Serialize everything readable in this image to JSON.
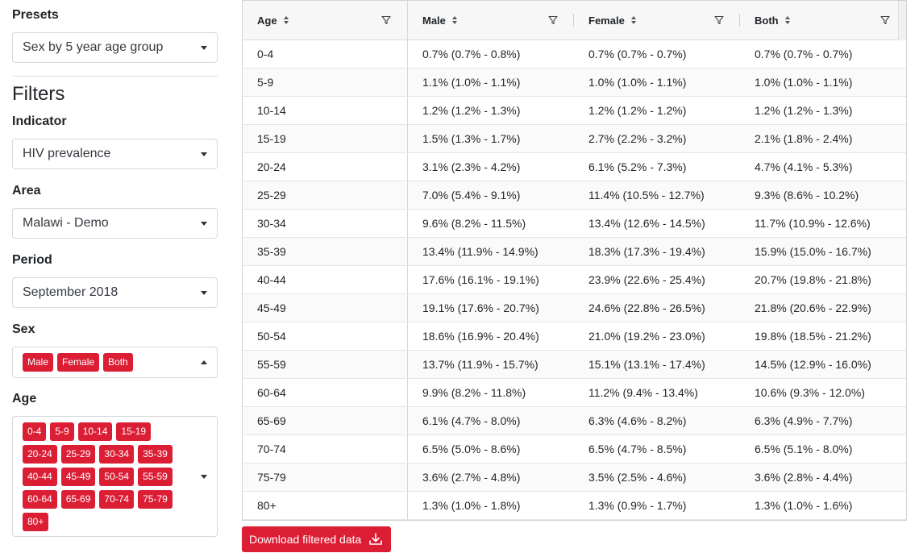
{
  "sidebar": {
    "presets": {
      "label": "Presets",
      "selected": "Sex by 5 year age group"
    },
    "filters_title": "Filters",
    "indicator": {
      "label": "Indicator",
      "selected": "HIV prevalence"
    },
    "area": {
      "label": "Area",
      "selected": "Malawi - Demo"
    },
    "period": {
      "label": "Period",
      "selected": "September 2018"
    },
    "sex": {
      "label": "Sex",
      "tags": [
        "Male",
        "Female",
        "Both"
      ]
    },
    "age": {
      "label": "Age",
      "tags": [
        "0-4",
        "5-9",
        "10-14",
        "15-19",
        "20-24",
        "25-29",
        "30-34",
        "35-39",
        "40-44",
        "45-49",
        "50-54",
        "55-59",
        "60-64",
        "65-69",
        "70-74",
        "75-79",
        "80+"
      ]
    }
  },
  "table": {
    "columns": [
      "Age",
      "Male",
      "Female",
      "Both"
    ],
    "rows": [
      [
        "0-4",
        "0.7% (0.7% - 0.8%)",
        "0.7% (0.7% - 0.7%)",
        "0.7% (0.7% - 0.7%)"
      ],
      [
        "5-9",
        "1.1% (1.0% - 1.1%)",
        "1.0% (1.0% - 1.1%)",
        "1.0% (1.0% - 1.1%)"
      ],
      [
        "10-14",
        "1.2% (1.2% - 1.3%)",
        "1.2% (1.2% - 1.2%)",
        "1.2% (1.2% - 1.3%)"
      ],
      [
        "15-19",
        "1.5% (1.3% - 1.7%)",
        "2.7% (2.2% - 3.2%)",
        "2.1% (1.8% - 2.4%)"
      ],
      [
        "20-24",
        "3.1% (2.3% - 4.2%)",
        "6.1% (5.2% - 7.3%)",
        "4.7% (4.1% - 5.3%)"
      ],
      [
        "25-29",
        "7.0% (5.4% - 9.1%)",
        "11.4% (10.5% - 12.7%)",
        "9.3% (8.6% - 10.2%)"
      ],
      [
        "30-34",
        "9.6% (8.2% - 11.5%)",
        "13.4% (12.6% - 14.5%)",
        "11.7% (10.9% - 12.6%)"
      ],
      [
        "35-39",
        "13.4% (11.9% - 14.9%)",
        "18.3% (17.3% - 19.4%)",
        "15.9% (15.0% - 16.7%)"
      ],
      [
        "40-44",
        "17.6% (16.1% - 19.1%)",
        "23.9% (22.6% - 25.4%)",
        "20.7% (19.8% - 21.8%)"
      ],
      [
        "45-49",
        "19.1% (17.6% - 20.7%)",
        "24.6% (22.8% - 26.5%)",
        "21.8% (20.6% - 22.9%)"
      ],
      [
        "50-54",
        "18.6% (16.9% - 20.4%)",
        "21.0% (19.2% - 23.0%)",
        "19.8% (18.5% - 21.2%)"
      ],
      [
        "55-59",
        "13.7% (11.9% - 15.7%)",
        "15.1% (13.1% - 17.4%)",
        "14.5% (12.9% - 16.0%)"
      ],
      [
        "60-64",
        "9.9% (8.2% - 11.8%)",
        "11.2% (9.4% - 13.4%)",
        "10.6% (9.3% - 12.0%)"
      ],
      [
        "65-69",
        "6.1% (4.7% - 8.0%)",
        "6.3% (4.6% - 8.2%)",
        "6.3% (4.9% - 7.7%)"
      ],
      [
        "70-74",
        "6.5% (5.0% - 8.6%)",
        "6.5% (4.7% - 8.5%)",
        "6.5% (5.1% - 8.0%)"
      ],
      [
        "75-79",
        "3.6% (2.7% - 4.8%)",
        "3.5% (2.5% - 4.6%)",
        "3.6% (2.8% - 4.4%)"
      ],
      [
        "80+",
        "1.3% (1.0% - 1.8%)",
        "1.3% (0.9% - 1.7%)",
        "1.3% (1.0% - 1.6%)"
      ]
    ]
  },
  "download": {
    "label": "Download filtered data",
    "icon": "download-icon"
  },
  "colors": {
    "accent": "#dc1e35"
  }
}
